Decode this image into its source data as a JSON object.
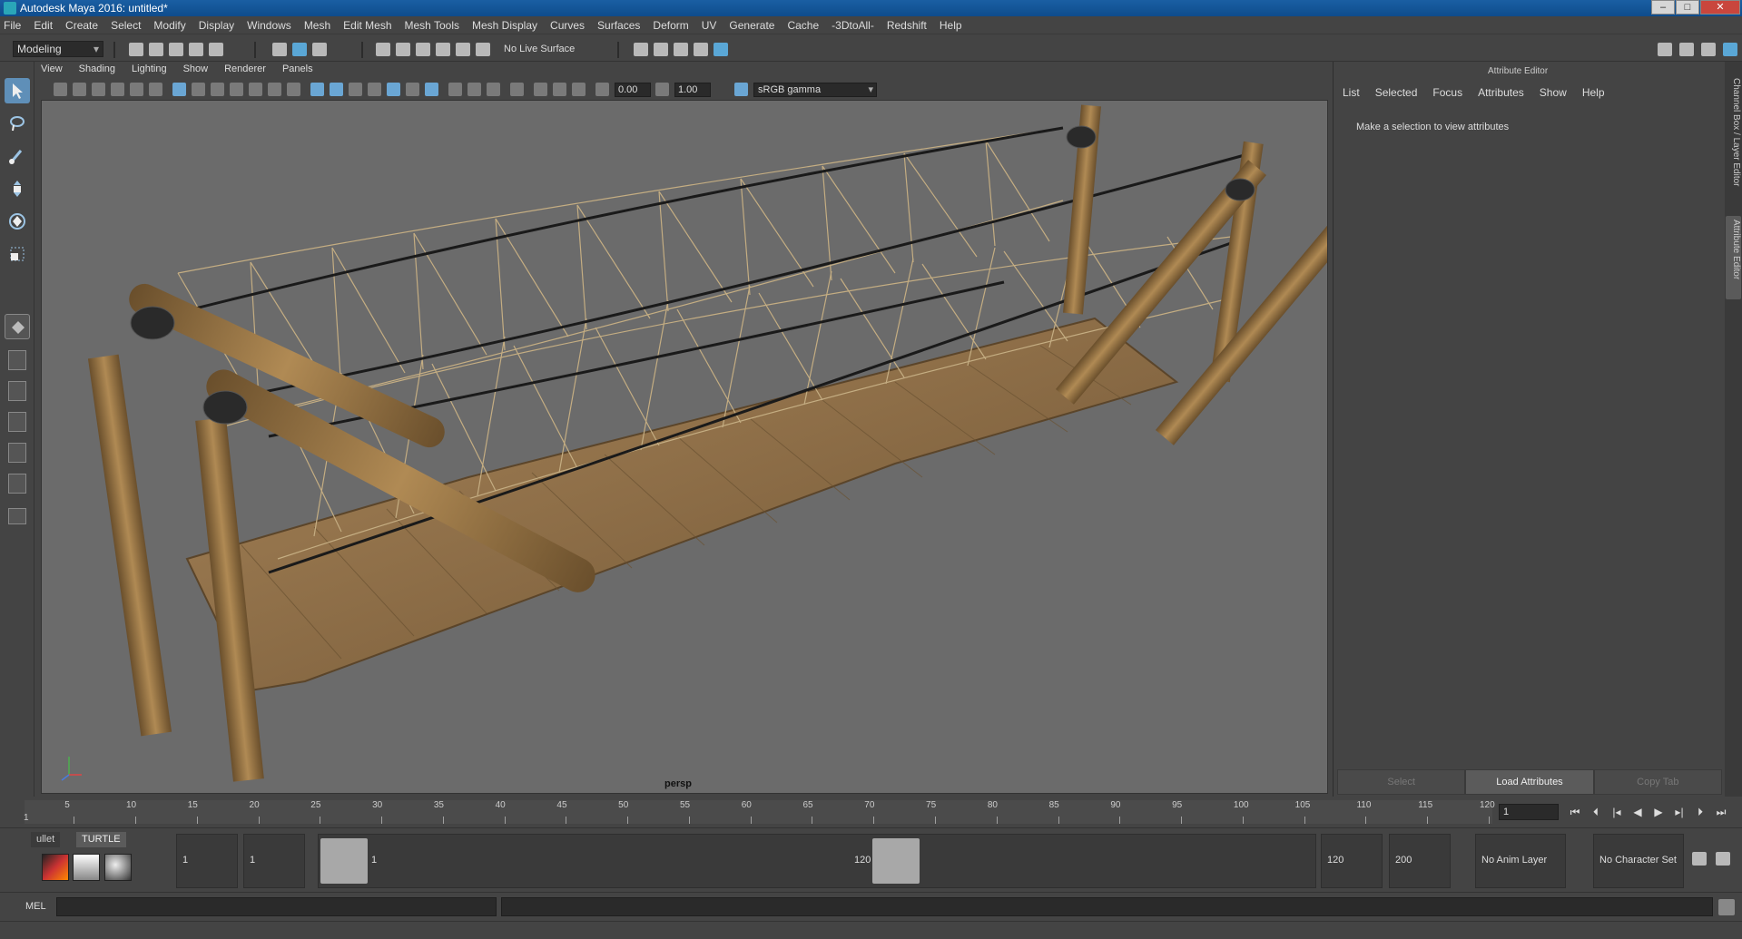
{
  "window": {
    "title": "Autodesk Maya 2016: untitled*",
    "controls": [
      "–",
      "□",
      "✕"
    ]
  },
  "menubar": [
    "File",
    "Edit",
    "Create",
    "Select",
    "Modify",
    "Display",
    "Windows",
    "Mesh",
    "Edit Mesh",
    "Mesh Tools",
    "Mesh Display",
    "Curves",
    "Surfaces",
    "Deform",
    "UV",
    "Generate",
    "Cache",
    "-3DtoAll-",
    "Redshift",
    "Help"
  ],
  "statusline": {
    "mode": "Modeling",
    "live_surface": "No Live Surface"
  },
  "panel": {
    "menu": [
      "View",
      "Shading",
      "Lighting",
      "Show",
      "Renderer",
      "Panels"
    ],
    "exposure": "0.00",
    "gamma": "1.00",
    "color_space": "sRGB gamma",
    "camera": "persp"
  },
  "attribute_editor": {
    "title": "Attribute Editor",
    "menu": [
      "List",
      "Selected",
      "Focus",
      "Attributes",
      "Show",
      "Help"
    ],
    "hint": "Make a selection to view attributes",
    "buttons": [
      "Select",
      "Load Attributes",
      "Copy Tab"
    ]
  },
  "side_tabs": [
    "Channel Box / Layer Editor",
    "Attribute Editor"
  ],
  "timeslider": {
    "ticks": [
      "5",
      "10",
      "15",
      "20",
      "25",
      "30",
      "35",
      "40",
      "45",
      "50",
      "55",
      "60",
      "65",
      "70",
      "75",
      "80",
      "85",
      "90",
      "95",
      "100",
      "105",
      "110",
      "115",
      "120"
    ],
    "start_label": "1",
    "current_frame": "1"
  },
  "range": {
    "shelf_tabs": [
      "ullet",
      "TURTLE"
    ],
    "start": "1",
    "playback_start": "1",
    "slider_min": "1",
    "slider_max": "120",
    "playback_end": "120",
    "end": "200",
    "anim_layer": "No Anim Layer",
    "character_set": "No Character Set"
  },
  "command_line": {
    "label": "MEL"
  },
  "colors": {
    "accent": "#5f8fb8",
    "titlebar": "#0e4c8c",
    "viewport_bg": "#6b6b6b",
    "wood": "#8a6a3d",
    "rope": "#c4ad82"
  }
}
